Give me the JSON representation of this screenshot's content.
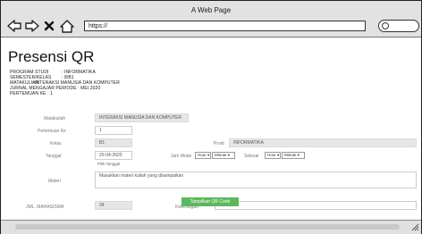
{
  "window": {
    "title": "A Web Page"
  },
  "toolbar": {
    "url": "https://",
    "back_icon": "back-arrow-icon",
    "forward_icon": "forward-arrow-icon",
    "stop_icon": "close-icon",
    "home_icon": "home-icon",
    "search_icon": "search-icon"
  },
  "page": {
    "title": "Presensi QR",
    "info": [
      {
        "key": "PROGRAM STUDI",
        "value": ": INFORMATIKA"
      },
      {
        "key": "SEMESTER/KELAS",
        "value": ": 8/B1"
      },
      {
        "key": "MATAKULIAH",
        "value": ": INTERAKSI MANUSIA DAN KOMPUTER"
      },
      {
        "key": "JURNAL MENGAJAR PERIODE",
        "value": ": MEI 2020"
      },
      {
        "key": "PERTEMUAN KE",
        "value": ": 1"
      }
    ]
  },
  "form": {
    "matakuliah": {
      "label": "Matakuliah",
      "value": "INTERAKSI MANUSIA DAN KOMPUTER"
    },
    "pertemuan": {
      "label": "Pertemuan Ke",
      "value": "1"
    },
    "kelas": {
      "label": "Kelas",
      "value": "B1"
    },
    "prodi": {
      "label": "Prodi",
      "value": "INFORMATIKA"
    },
    "tanggal": {
      "label": "Tanggal",
      "value": "25-04-2020",
      "hint": "Pilih Tanggal"
    },
    "jam_mulai": {
      "label": "Jam Mulai",
      "hour": "Hour",
      "minute": "Minute"
    },
    "selesai": {
      "label": "Selesai",
      "hour": "Hour",
      "minute": "Minute"
    },
    "materi": {
      "label": "Materi",
      "placeholder": "Masukkan materi kuliah yang disampaikan"
    },
    "jumlah_mahasiswa": {
      "label": "JML. MAHASISWA",
      "value": "34"
    },
    "keterangan": {
      "label": "Keterangan",
      "value": ""
    },
    "submit_label": "Tampilkan QR Code"
  }
}
